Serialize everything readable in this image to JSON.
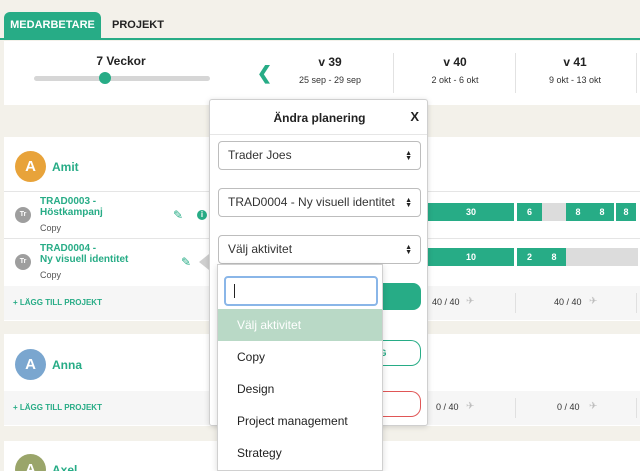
{
  "tabs": [
    {
      "label": "MEDARBETARE",
      "active": true
    },
    {
      "label": "PROJEKT",
      "active": false
    }
  ],
  "header": {
    "weeks_label": "7 Veckor",
    "weeks": [
      {
        "num": "v 39",
        "dates": "25 sep - 29 sep"
      },
      {
        "num": "v 40",
        "dates": "2 okt - 6 okt"
      },
      {
        "num": "v 41",
        "dates": "9 okt - 13 okt"
      }
    ]
  },
  "people": [
    {
      "initial": "A",
      "name": "Amit",
      "avatar_color": "#e8a33a",
      "projects": [
        {
          "code": "TRAD0003 -",
          "name": "Höstkampanj",
          "activity": "Copy",
          "mini": "Tr",
          "bars": [
            "30",
            "6",
            "8",
            "8",
            "8"
          ]
        },
        {
          "code": "TRAD0004 -",
          "name": "Ny visuell identitet",
          "activity": "Copy",
          "mini": "Tr",
          "bars": [
            "10",
            "2",
            "8"
          ]
        }
      ],
      "add_label": "+ LÄGG TILL PROJEKT",
      "totals": [
        "40 / 40",
        "40 / 40"
      ]
    },
    {
      "initial": "A",
      "name": "Anna",
      "avatar_color": "#7aa6cf",
      "add_label": "+ LÄGG TILL PROJEKT",
      "totals": [
        "0 / 40",
        "0 / 40"
      ]
    },
    {
      "initial": "A",
      "name": "Axel",
      "avatar_color": "#9aa56a"
    }
  ],
  "modal": {
    "title": "Ändra planering",
    "close": "X",
    "client_select": "Trader Joes",
    "project_select": "TRAD0004 - Ny visuell identitet",
    "activity_select": "Välj aktivitet",
    "partial_button_text": "NG"
  },
  "dropdown": {
    "search_value": "",
    "items": [
      "Välj aktivitet",
      "Copy",
      "Design",
      "Project management",
      "Strategy"
    ],
    "selected_index": 0
  },
  "colors": {
    "accent": "#27ac86",
    "danger": "#e05656"
  }
}
